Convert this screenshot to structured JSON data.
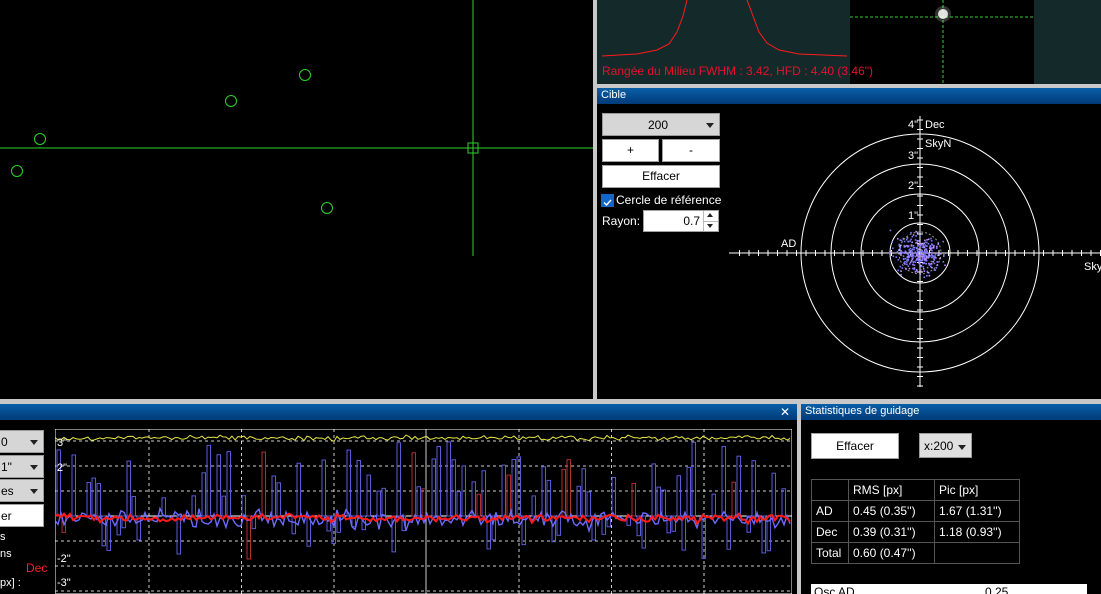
{
  "profile_panel": {
    "caption": "Rangée du Milieu FWHM : 3.42, HFD : 4.40 (3.46\")"
  },
  "target_panel": {
    "title": "Cible",
    "length_value": "200",
    "plus_label": "+",
    "minus_label": "-",
    "clear_label": "Effacer",
    "ref_circle_label": "Cercle de référence",
    "ref_circle_checked": true,
    "radius_label": "Rayon:",
    "radius_value": "0.7",
    "plot": {
      "axis_dec": "Dec",
      "axis_skyn": "SkyN",
      "axis_ad": "AD",
      "axis_sky_right": "Sky",
      "ring_labels": [
        "1\"",
        "2\"",
        "3\"",
        "4\""
      ]
    }
  },
  "graph_panel": {
    "close_label": "✕",
    "left_controls": {
      "combo1": "0",
      "combo2": "1\"",
      "combo3": "es",
      "button": "er",
      "label1": "s",
      "label2": "ns",
      "dec_label": "Dec",
      "px_label": "px] :"
    },
    "y_labels": [
      "3\"",
      "2\"",
      "-2\"",
      "-3\""
    ]
  },
  "stats_panel": {
    "title": "Statistiques de guidage",
    "clear_label": "Effacer",
    "scale_value": "x:200",
    "headers": [
      "",
      "RMS [px]",
      "Pic [px]"
    ],
    "rows": [
      [
        "AD",
        "0.45 (0.35'')",
        "1.67 (1.31'')"
      ],
      [
        "Dec",
        "0.39 (0.31'')",
        "1.18 (0.93'')"
      ],
      [
        "Total",
        "0.60 (0.47'')",
        ""
      ]
    ],
    "bottom_label": "Osc AD",
    "bottom_value": "0.25"
  },
  "colors": {
    "green": "#2bd42b",
    "red": "#ff1a1a",
    "blue": "#6b6bff",
    "yellow": "#e8e84a",
    "titlebar": "#0a5fa8"
  }
}
